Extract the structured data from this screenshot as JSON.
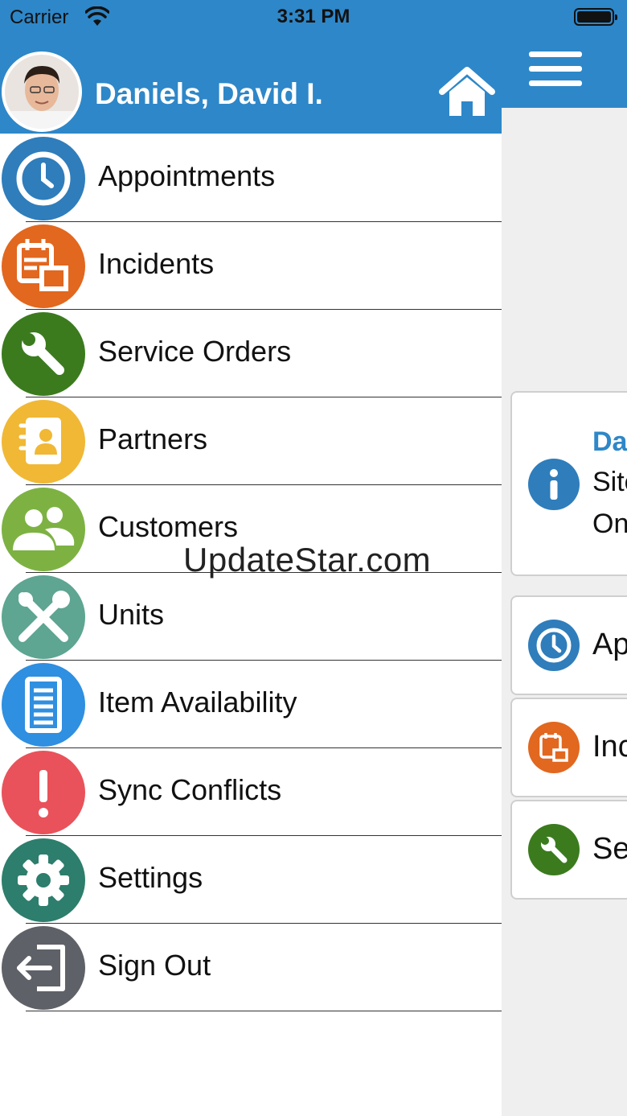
{
  "status_bar": {
    "carrier": "Carrier",
    "time": "3:31 PM"
  },
  "drawer": {
    "user_name": "Daniels, David I.",
    "menu": [
      {
        "label": "Appointments",
        "icon": "clock-icon",
        "color": "#2f7dbb"
      },
      {
        "label": "Incidents",
        "icon": "calendar-icon",
        "color": "#e2671f"
      },
      {
        "label": "Service Orders",
        "icon": "wrench-icon",
        "color": "#3b7b1e"
      },
      {
        "label": "Partners",
        "icon": "address-book-icon",
        "color": "#f0b835"
      },
      {
        "label": "Customers",
        "icon": "people-icon",
        "color": "#7db243"
      },
      {
        "label": "Units",
        "icon": "tools-icon",
        "color": "#5ea592"
      },
      {
        "label": "Item Availability",
        "icon": "list-icon",
        "color": "#2f8fe0"
      },
      {
        "label": "Sync Conflicts",
        "icon": "exclamation-icon",
        "color": "#e9525a"
      },
      {
        "label": "Settings",
        "icon": "gear-icon",
        "color": "#2d7e6c"
      },
      {
        "label": "Sign Out",
        "icon": "sign-out-icon",
        "color": "#5f6168"
      }
    ]
  },
  "background_cards": {
    "info_title": "Da",
    "info_line1": "Site",
    "info_line2": "On",
    "card1": "Ap",
    "card2": "Inc",
    "card3": "Se"
  },
  "watermark": "UpdateStar.com"
}
